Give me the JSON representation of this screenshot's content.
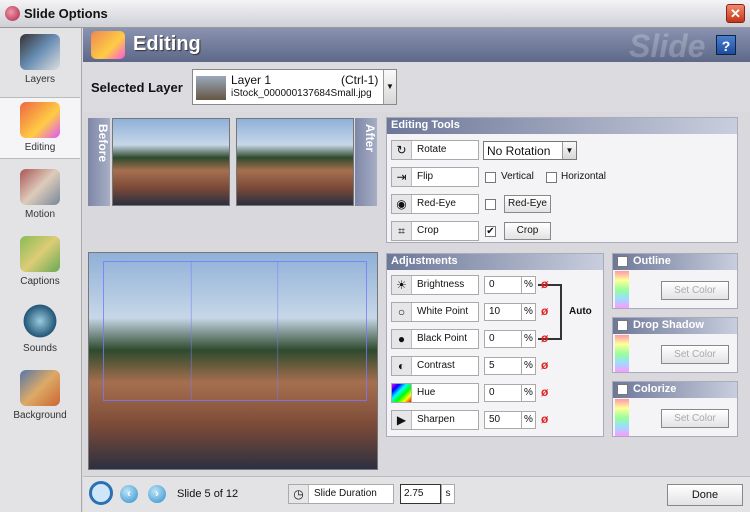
{
  "window": {
    "title": "Slide Options",
    "close": "✕"
  },
  "sidebar": {
    "items": [
      {
        "label": "Layers",
        "color": "#4b6a8a"
      },
      {
        "label": "Editing",
        "color": "#e8a040"
      },
      {
        "label": "Motion",
        "color": "#8a6a5a"
      },
      {
        "label": "Captions",
        "color": "#5a8a4a"
      },
      {
        "label": "Sounds",
        "color": "#3a7aa0"
      },
      {
        "label": "Background",
        "color": "#a07a4a"
      }
    ]
  },
  "header": {
    "title": "Editing",
    "watermark": "Slide",
    "help": "?"
  },
  "layer": {
    "label": "Selected Layer",
    "name": "Layer  1",
    "shortcut": "(Ctrl-1)",
    "file": "iStock_000000137684Small.jpg"
  },
  "preview": {
    "before": "Before",
    "after": "After"
  },
  "editing_tools": {
    "title": "Editing Tools",
    "rotate": {
      "label": "Rotate",
      "value": "No Rotation"
    },
    "flip": {
      "label": "Flip",
      "vertical": "Vertical",
      "horizontal": "Horizontal"
    },
    "redeye": {
      "label": "Red-Eye",
      "button": "Red-Eye"
    },
    "crop": {
      "label": "Crop",
      "button": "Crop",
      "check": "✔"
    }
  },
  "adjustments": {
    "title": "Adjustments",
    "auto": "Auto",
    "items": [
      {
        "label": "Brightness",
        "value": "0",
        "unit": "%",
        "icon": "☀"
      },
      {
        "label": "White Point",
        "value": "10",
        "unit": "%",
        "icon": "○"
      },
      {
        "label": "Black Point",
        "value": "0",
        "unit": "%",
        "icon": "●"
      },
      {
        "label": "Contrast",
        "value": "5",
        "unit": "%",
        "icon": "◐"
      },
      {
        "label": "Hue",
        "value": "0",
        "unit": "%",
        "icon": ""
      },
      {
        "label": "Sharpen",
        "value": "50",
        "unit": "%",
        "icon": "▶"
      }
    ]
  },
  "effects": [
    {
      "title": "Outline",
      "button": "Set Color"
    },
    {
      "title": "Drop Shadow",
      "button": "Set Color"
    },
    {
      "title": "Colorize",
      "button": "Set Color"
    }
  ],
  "footer": {
    "slide": "Slide 5 of 12",
    "duration_label": "Slide Duration",
    "duration": "2.75",
    "unit": "s",
    "done": "Done"
  }
}
